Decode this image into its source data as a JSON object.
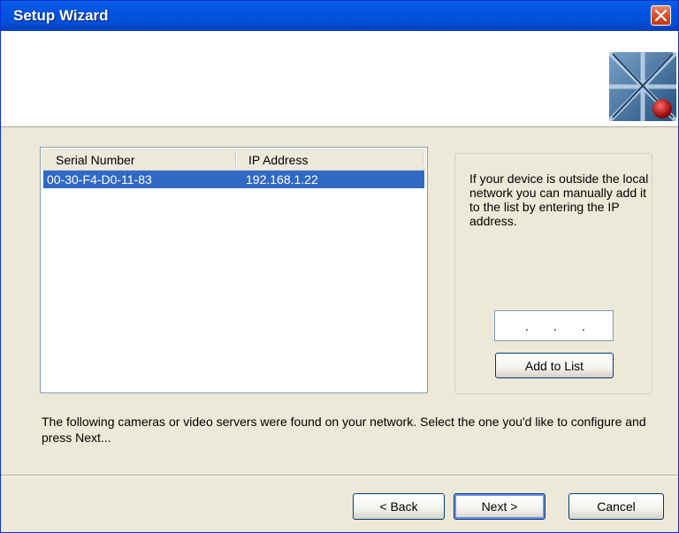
{
  "window": {
    "title": "Setup Wizard",
    "close_icon": "close-icon"
  },
  "device_list": {
    "columns": [
      "Serial Number",
      "IP Address"
    ],
    "rows": [
      {
        "serial": "00-30-F4-D0-11-83",
        "ip": "192.168.1.22",
        "selected": true
      }
    ]
  },
  "manual_add": {
    "hint": "If your device is outside the local network you can manually add it to the list by entering the IP address.",
    "ip_value": [
      ".",
      ".",
      "."
    ],
    "add_label": "Add to List"
  },
  "description": "The following cameras or video servers were found on your network. Select the one you'd like to configure and press Next...",
  "buttons": {
    "back": "< Back",
    "next": "Next >",
    "cancel": "Cancel"
  },
  "colors": {
    "titlebar": "#0054e3",
    "selection": "#316ac5",
    "background": "#ece9d8"
  }
}
